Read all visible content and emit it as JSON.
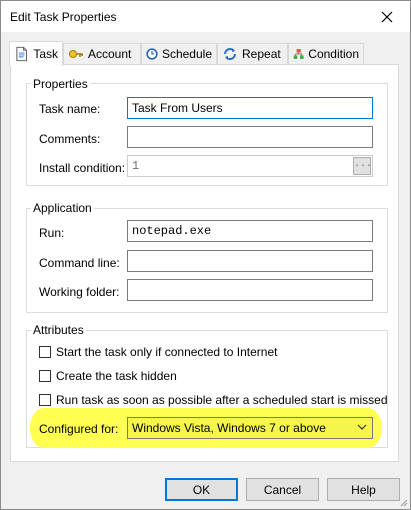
{
  "window": {
    "title": "Edit Task Properties"
  },
  "tabs": [
    {
      "label": "Task",
      "icon": "document-icon"
    },
    {
      "label": "Account",
      "icon": "key-icon"
    },
    {
      "label": "Schedule",
      "icon": "clock-icon"
    },
    {
      "label": "Repeat",
      "icon": "repeat-icon"
    },
    {
      "label": "Condition",
      "icon": "hierarchy-icon"
    }
  ],
  "properties": {
    "legend": "Properties",
    "task_name_label": "Task name:",
    "task_name_value": "Task From Users",
    "comments_label": "Comments:",
    "comments_value": "",
    "install_condition_label": "Install condition:",
    "install_condition_value": "1",
    "browse_label": "..."
  },
  "application": {
    "legend": "Application",
    "run_label": "Run:",
    "run_value": "notepad.exe",
    "command_line_label": "Command line:",
    "command_line_value": "",
    "working_folder_label": "Working folder:",
    "working_folder_value": ""
  },
  "attributes": {
    "legend": "Attributes",
    "internet_only_label": "Start the task only if connected to Internet",
    "hidden_label": "Create the task hidden",
    "run_missed_label": "Run task as soon as possible after a scheduled start is missed",
    "configured_for_label": "Configured for:",
    "configured_for_value": "Windows Vista, Windows 7 or above"
  },
  "buttons": {
    "ok": "OK",
    "cancel": "Cancel",
    "help": "Help"
  },
  "colors": {
    "highlight": "#ffff52",
    "focus": "#0078d7"
  }
}
